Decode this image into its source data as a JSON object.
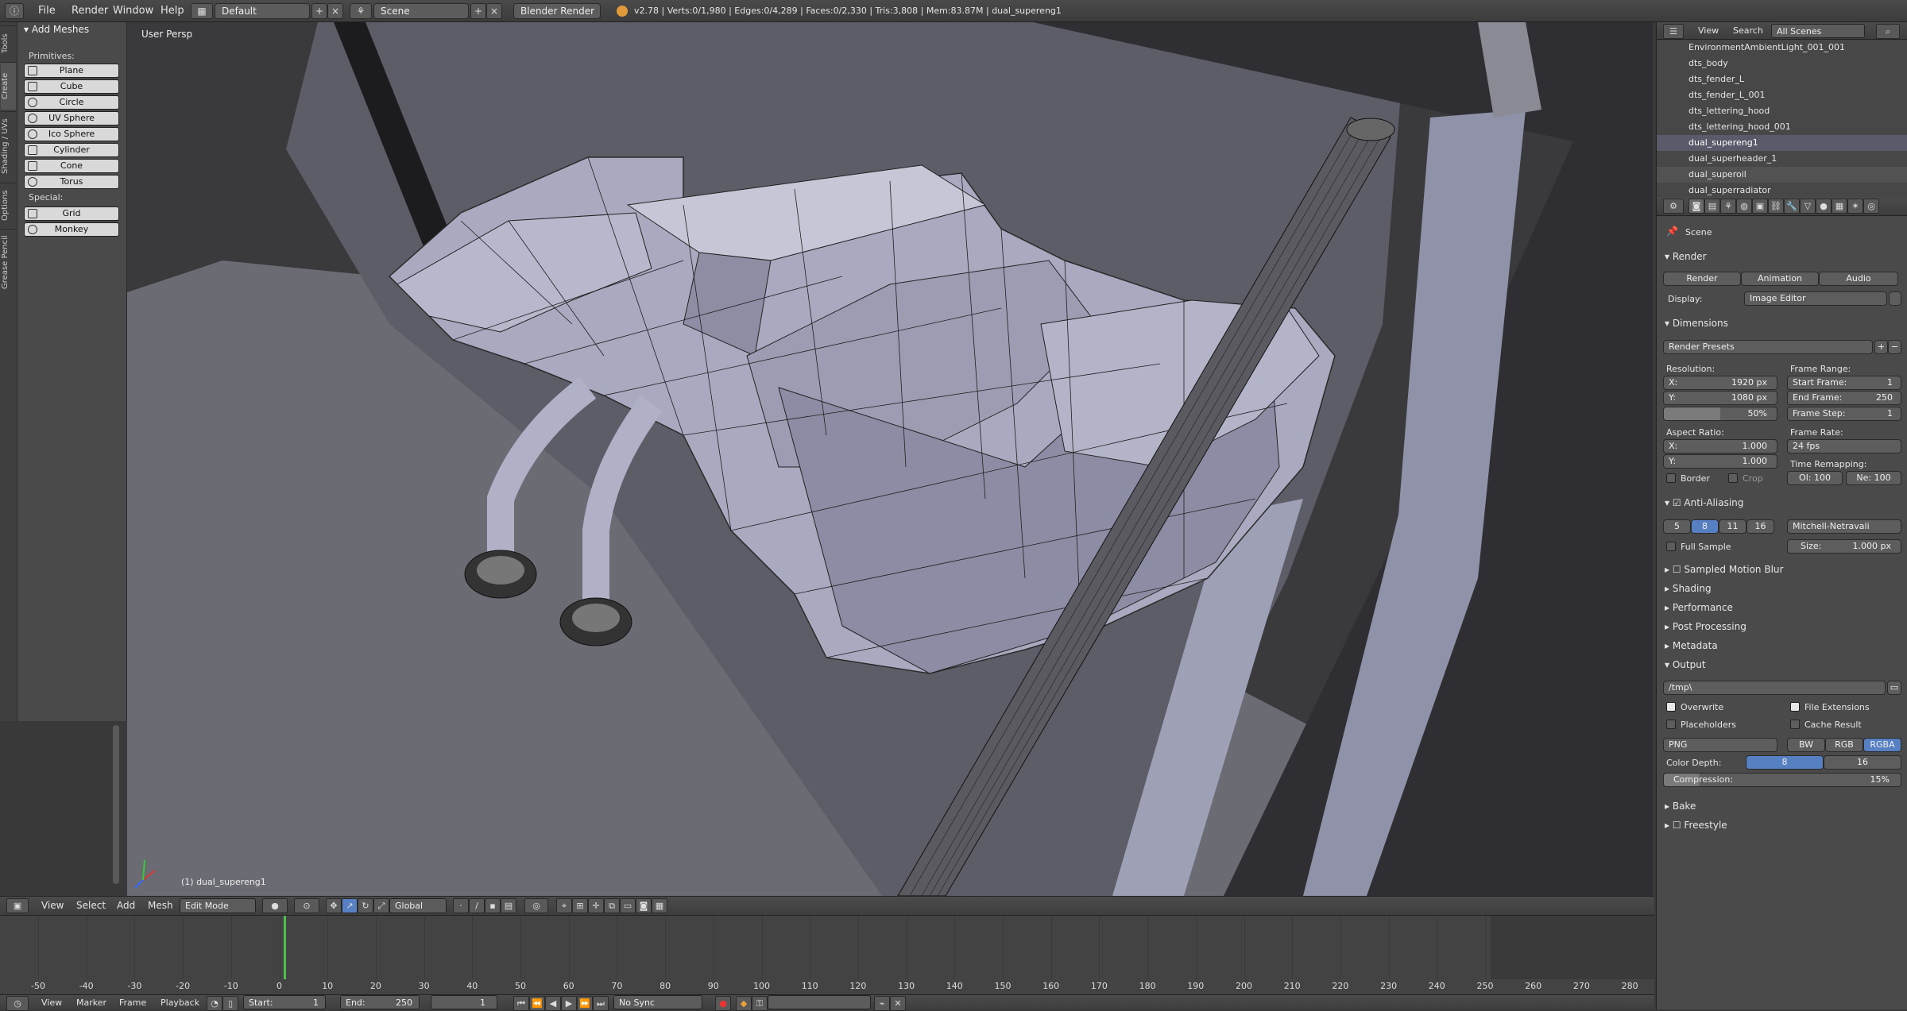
{
  "topbar": {
    "menus": [
      "File",
      "Render",
      "Window",
      "Help"
    ],
    "screen_layout": "Default",
    "scene": "Scene",
    "engine": "Blender Render",
    "stats": "v2.78 | Verts:0/1,980 | Edges:0/4,289 | Faces:0/2,330 | Tris:3,808 | Mem:83.87M | dual_supereng1"
  },
  "toolshelf": {
    "tabs": [
      "Tools",
      "Create",
      "Shading / UVs",
      "Options",
      "Grease Pencil"
    ],
    "panel_title": "Add Meshes",
    "primitives_label": "Primitives:",
    "primitives": [
      "Plane",
      "Cube",
      "Circle",
      "UV Sphere",
      "Ico Sphere",
      "Cylinder",
      "Cone",
      "Torus"
    ],
    "special_label": "Special:",
    "special": [
      "Grid",
      "Monkey"
    ]
  },
  "viewport": {
    "view_label": "User Persp",
    "object_label": "(1) dual_supereng1"
  },
  "viewport_header": {
    "menus": [
      "View",
      "Select",
      "Add",
      "Mesh"
    ],
    "mode": "Edit Mode",
    "orientation": "Global"
  },
  "timeline": {
    "ticks": [
      "-50",
      "-40",
      "-30",
      "-20",
      "-10",
      "0",
      "10",
      "20",
      "30",
      "40",
      "50",
      "60",
      "70",
      "80",
      "90",
      "100",
      "110",
      "120",
      "130",
      "140",
      "150",
      "160",
      "170",
      "180",
      "190",
      "200",
      "210",
      "220",
      "230",
      "240",
      "250",
      "260",
      "270",
      "280"
    ],
    "current_frame": 0,
    "footer_menus": [
      "View",
      "Marker",
      "Frame",
      "Playback"
    ],
    "start_label": "Start:",
    "start": "1",
    "end_label": "End:",
    "end": "250",
    "frame": "1",
    "sync": "No Sync"
  },
  "outliner": {
    "header_menus": [
      "View",
      "Search"
    ],
    "filter": "All Scenes",
    "rows": [
      "EnvironmentAmbientLight_001_001",
      "dts_body",
      "dts_fender_L",
      "dts_fender_L_001",
      "dts_lettering_hood",
      "dts_lettering_hood_001",
      "dual_supereng1",
      "dual_superheader_1",
      "dual_superoil",
      "dual_superradiator"
    ]
  },
  "properties": {
    "context": "Scene",
    "render_section": "Render",
    "render_buttons": [
      "Render",
      "Animation",
      "Audio"
    ],
    "display_label": "Display:",
    "display": "Image Editor",
    "dimensions": "Dimensions",
    "render_presets": "Render Presets",
    "resolution_label": "Resolution:",
    "res_x": "X:",
    "res_x_val": "1920 px",
    "res_y": "Y:",
    "res_y_val": "1080 px",
    "res_pct": "50%",
    "frame_range_label": "Frame Range:",
    "start_frame": "Start Frame:",
    "start_frame_val": "1",
    "end_frame": "End Frame:",
    "end_frame_val": "250",
    "frame_step": "Frame Step:",
    "frame_step_val": "1",
    "aspect_label": "Aspect Ratio:",
    "asp_x": "X:",
    "asp_x_val": "1.000",
    "asp_y": "Y:",
    "asp_y_val": "1.000",
    "frame_rate_label": "Frame Rate:",
    "frame_rate": "24 fps",
    "time_remap_label": "Time Remapping:",
    "remap_old": "Ol: 100",
    "remap_new": "Ne: 100",
    "border": "Border",
    "crop": "Crop",
    "aa": "Anti-Aliasing",
    "aa_samples": [
      "5",
      "8",
      "11",
      "16"
    ],
    "aa_filter": "Mitchell-Netravali",
    "full_sample": "Full Sample",
    "size": "Size:",
    "size_val": "1.000 px",
    "sections": [
      "Sampled Motion Blur",
      "Shading",
      "Performance",
      "Post Processing",
      "Metadata"
    ],
    "output": "Output",
    "path": "/tmp\\",
    "overwrite": "Overwrite",
    "file_ext": "File Extensions",
    "placeholders": "Placeholders",
    "cache": "Cache Result",
    "format": "PNG",
    "color_modes": [
      "BW",
      "RGB",
      "RGBA"
    ],
    "color_depth_label": "Color Depth:",
    "depth_vals": [
      "8",
      "16"
    ],
    "compression_label": "Compression:",
    "compression": "15%",
    "bake": "Bake",
    "freestyle": "Freestyle"
  }
}
